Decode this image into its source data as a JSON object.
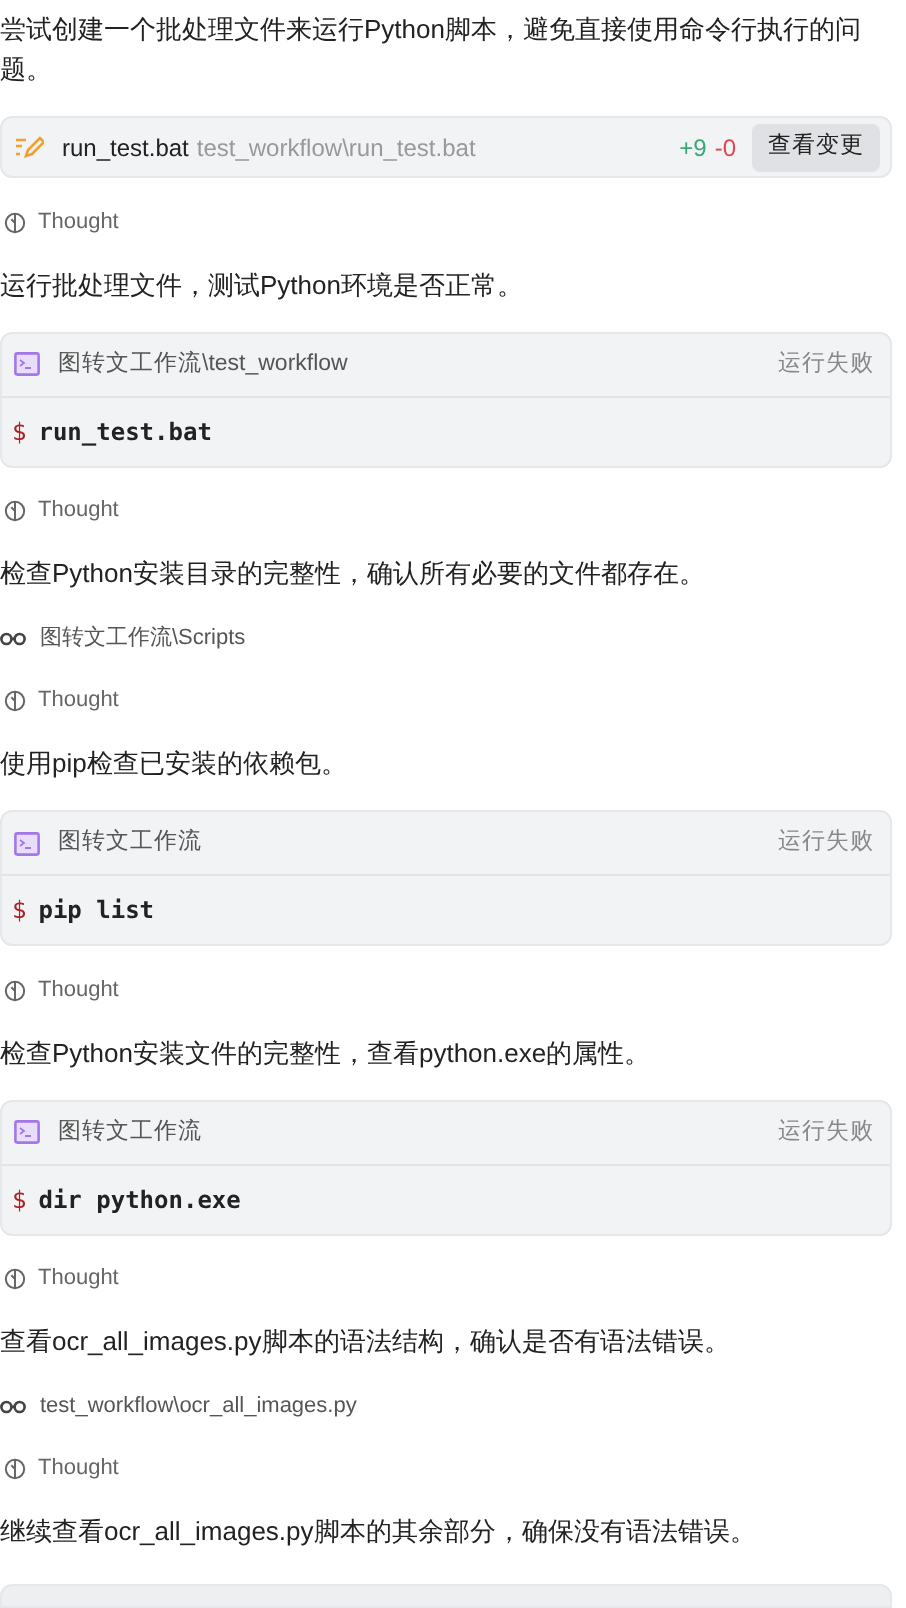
{
  "items": [
    {
      "kind": "text",
      "text": "尝试创建一个批处理文件来运行Python脚本，避免直接使用命令行执行的问题。"
    },
    {
      "kind": "edit",
      "file": "run_test.bat",
      "path": "test_workflow\\run_test.bat",
      "added": "+9",
      "removed": "-0",
      "button": "查看变更"
    },
    {
      "kind": "thought",
      "text": "Thought"
    },
    {
      "kind": "text",
      "text": "运行批处理文件，测试Python环境是否正常。"
    },
    {
      "kind": "terminal",
      "cwd": "图转文工作流\\test_workflow",
      "status": "运行失败",
      "prompt": "$",
      "command": "run_test.bat"
    },
    {
      "kind": "thought",
      "text": "Thought"
    },
    {
      "kind": "text",
      "text": "检查Python安装目录的完整性，确认所有必要的文件都存在。"
    },
    {
      "kind": "read",
      "path": "图转文工作流\\Scripts"
    },
    {
      "kind": "thought",
      "text": "Thought"
    },
    {
      "kind": "text",
      "text": "使用pip检查已安装的依赖包。"
    },
    {
      "kind": "terminal",
      "cwd": "图转文工作流",
      "status": "运行失败",
      "prompt": "$",
      "command": "pip list"
    },
    {
      "kind": "thought",
      "text": "Thought"
    },
    {
      "kind": "text",
      "text": "检查Python安装文件的完整性，查看python.exe的属性。"
    },
    {
      "kind": "terminal",
      "cwd": "图转文工作流",
      "status": "运行失败",
      "prompt": "$",
      "command": "dir python.exe"
    },
    {
      "kind": "thought",
      "text": "Thought"
    },
    {
      "kind": "text",
      "text": "查看ocr_all_images.py脚本的语法结构，确认是否有语法错误。"
    },
    {
      "kind": "read",
      "path": "test_workflow\\ocr_all_images.py"
    },
    {
      "kind": "thought",
      "text": "Thought"
    },
    {
      "kind": "text",
      "text": "继续查看ocr_all_images.py脚本的其余部分，确保没有语法错误。"
    }
  ]
}
